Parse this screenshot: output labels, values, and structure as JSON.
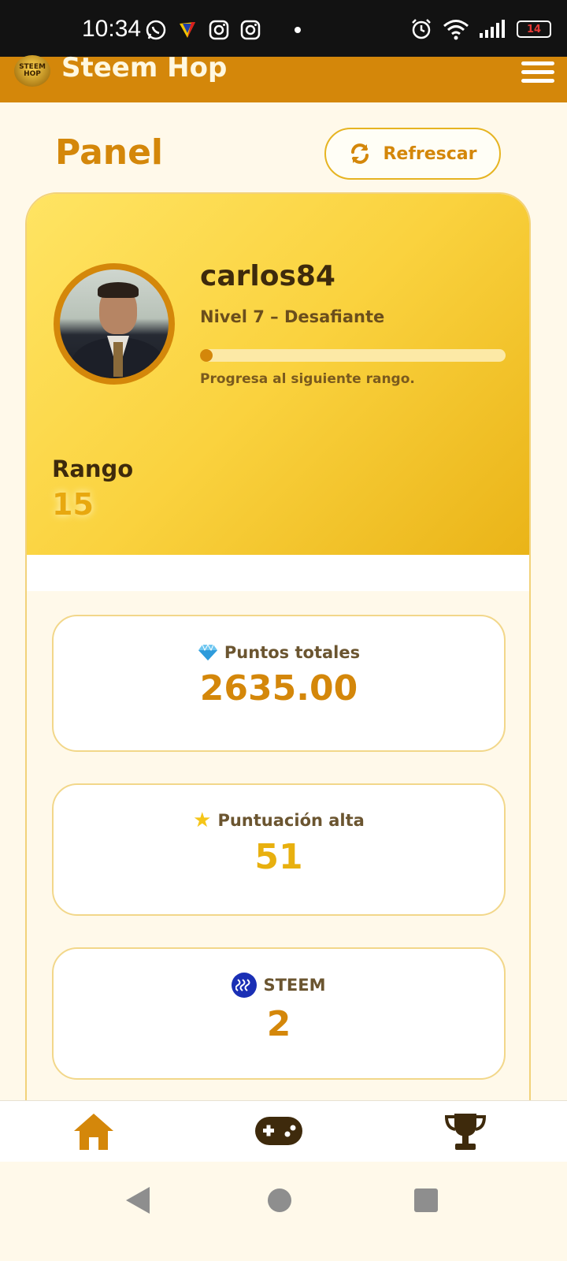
{
  "status_bar": {
    "time": "10:34",
    "battery": "14"
  },
  "header": {
    "app_title": "Steem Hop",
    "logo_text": "STEEM HOP"
  },
  "page": {
    "title": "Panel",
    "refresh_label": "Refrescar"
  },
  "profile": {
    "username": "carlos84",
    "level": "Nivel 7 – Desafiante",
    "progress_fraction": 0.02,
    "progress_caption": "Progresa al siguiente rango.",
    "rank_label": "Rango",
    "rank_value": "15"
  },
  "stats": [
    {
      "icon": "gem-icon",
      "label": "Puntos totales",
      "value": "2635.00",
      "color": "#D4870A"
    },
    {
      "icon": "star-icon",
      "label": "Puntuación alta",
      "value": "51",
      "color": "#E8B00F"
    },
    {
      "icon": "steem-icon",
      "label": "STEEM",
      "value": "2",
      "color": "#D4870A"
    }
  ],
  "bottom_nav": {
    "items": [
      "home-icon",
      "gamepad-icon",
      "trophy-icon"
    ]
  },
  "colors": {
    "brand": "#D4870A",
    "accent": "#F5C518",
    "background": "#FFF9EA"
  }
}
